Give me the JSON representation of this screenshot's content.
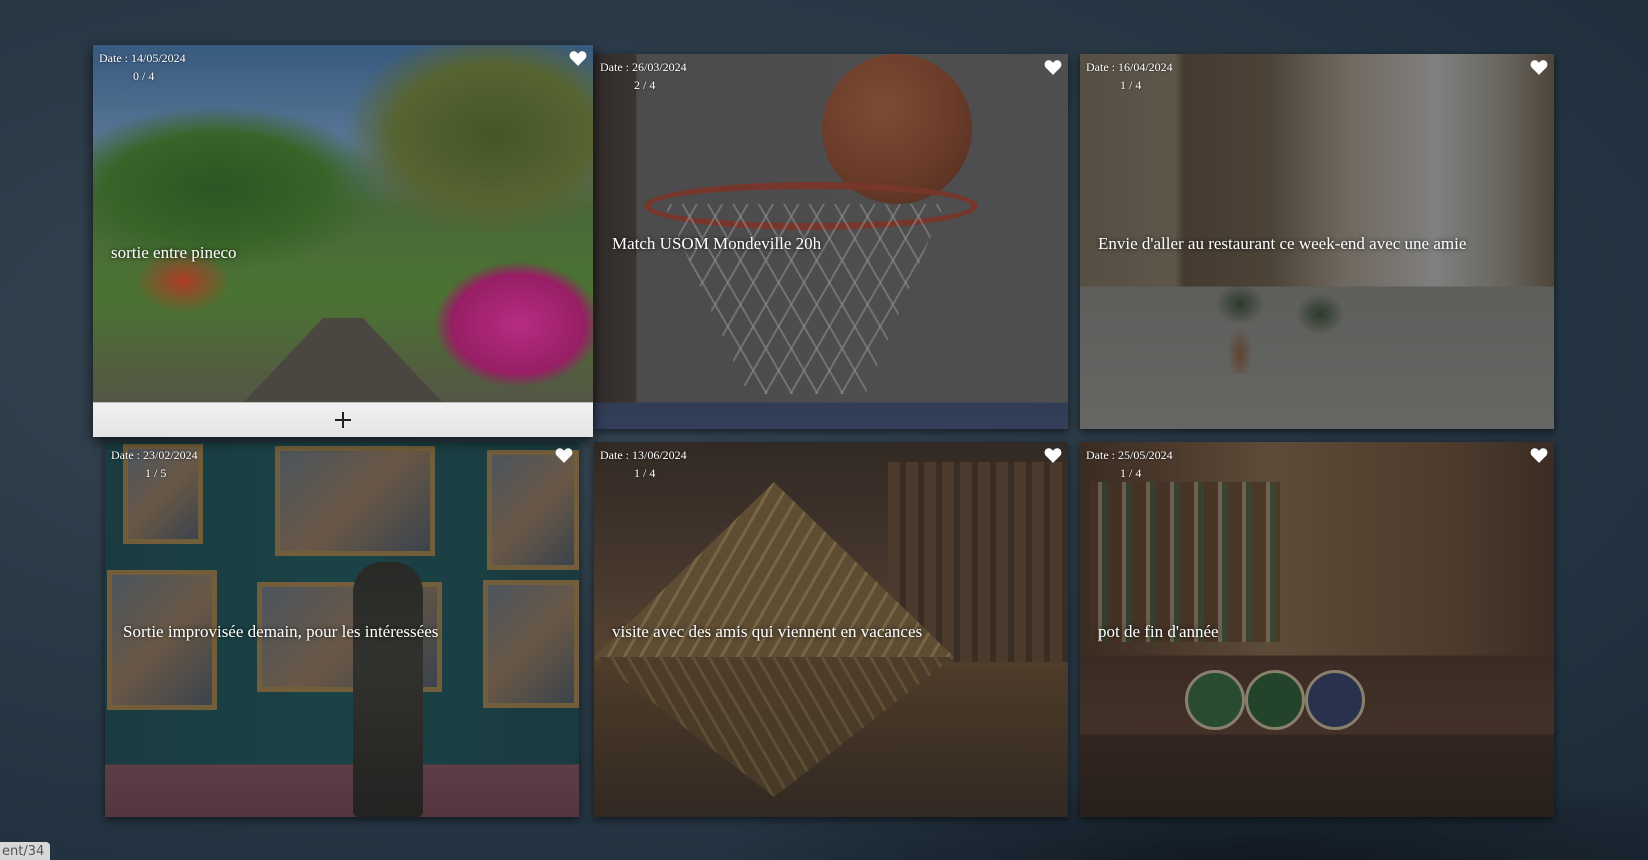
{
  "add_symbol": "+",
  "tab_label": "ent/34",
  "colors": {
    "page_background": "#2b3b48",
    "card_text": "#ffffff",
    "add_bar": "#eeeeee"
  },
  "cards": [
    {
      "date": "Date : 14/05/2024",
      "count": "0 / 4",
      "title": "sortie entre pineco",
      "favorite_icon": "heart-icon",
      "active": true
    },
    {
      "date": "Date : 26/03/2024",
      "count": "2 / 4",
      "title": "Match USOM Mondeville 20h",
      "favorite_icon": "heart-icon"
    },
    {
      "date": "Date : 16/04/2024",
      "count": "1 / 4",
      "title": "Envie d'aller au restaurant ce week-end avec une amie",
      "favorite_icon": "heart-icon"
    },
    {
      "date": "Date : 23/02/2024",
      "count": "1 / 5",
      "title": "Sortie improvisée demain, pour les intéressées",
      "favorite_icon": "heart-icon"
    },
    {
      "date": "Date : 13/06/2024",
      "count": "1 / 4",
      "title": "visite avec des amis qui viennent en vacances",
      "favorite_icon": "heart-icon"
    },
    {
      "date": "Date : 25/05/2024",
      "count": "1 / 4",
      "title": "pot de fin d'année",
      "favorite_icon": "heart-icon"
    }
  ]
}
